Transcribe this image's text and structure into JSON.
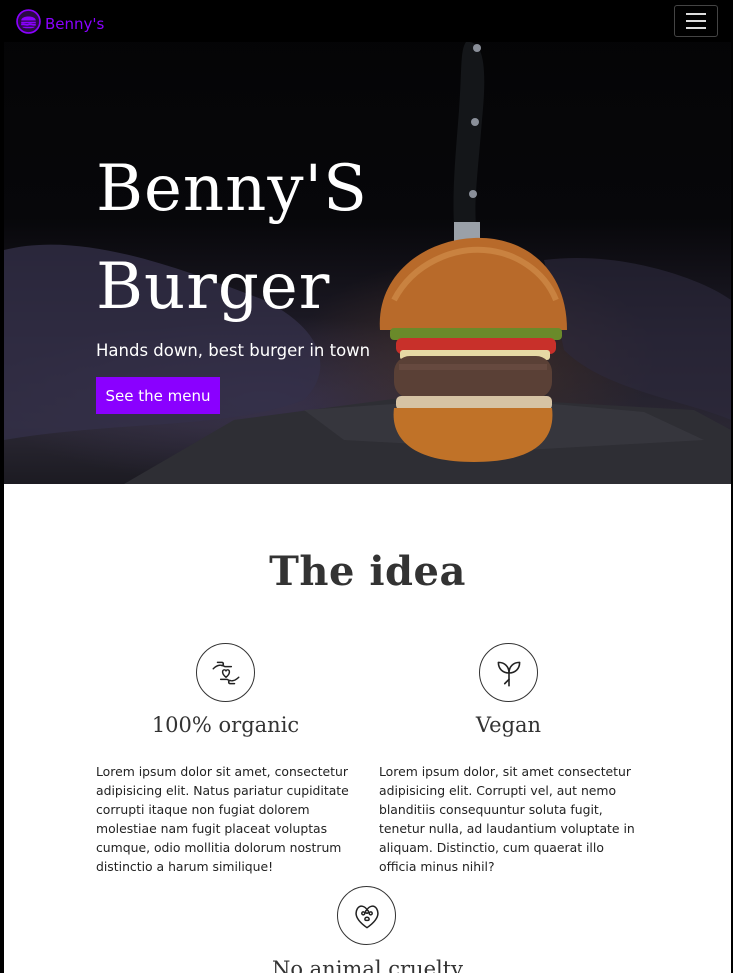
{
  "navbar": {
    "brand": "Benny's",
    "brand_icon": "burger-icon",
    "toggler_icon": "hamburger-menu-icon"
  },
  "hero": {
    "title_line1": "Benny'S",
    "title_line2": "Burger",
    "subtitle": "Hands down, best burger in town",
    "button_label": "See the menu"
  },
  "idea": {
    "title": "The idea",
    "features": [
      {
        "icon": "hands-heart-icon",
        "title": "100% organic",
        "text": "Lorem ipsum dolor sit amet, consectetur adipisicing elit. Natus pariatur cupiditate corrupti itaque non fugiat dolorem molestiae nam fugit placeat voluptas cumque, odio mollitia dolorum nostrum distinctio a harum similique!"
      },
      {
        "icon": "sprout-icon",
        "title": "Vegan",
        "text": "Lorem ipsum dolor, sit amet consectetur adipisicing elit. Corrupti vel, aut nemo blanditiis consequuntur soluta fugit, tenetur nulla, ad laudantium voluptate in aliquam. Distinctio, cum quaerat illo officia minus nihil?"
      },
      {
        "icon": "paw-heart-icon",
        "title": "No animal cruelty"
      }
    ]
  },
  "colors": {
    "accent": "#8a00ff",
    "navbar_bg": "#000000",
    "heading": "#333333"
  }
}
